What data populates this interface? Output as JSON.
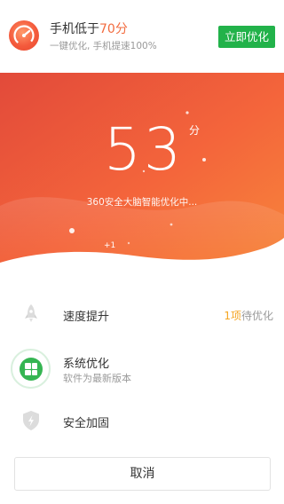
{
  "header": {
    "title_prefix": "手机低于",
    "title_score": "70分",
    "subtitle": "一键优化, 手机提速100%",
    "optimize_button": "立即优化",
    "logo_icon": "speedometer-icon"
  },
  "hero": {
    "score": "53",
    "score_unit": "分",
    "status_text": "360安全大脑智能优化中...",
    "increment_badge": "+1",
    "gradient_colors": [
      "#e8503a",
      "#f36a3a",
      "#f5833a"
    ]
  },
  "items": [
    {
      "title": "速度提升",
      "count": "1项",
      "status": "待优化",
      "icon": "rocket-icon"
    },
    {
      "title": "系统优化",
      "subtitle": "软件为最新版本",
      "icon": "apps-grid-icon"
    },
    {
      "title": "安全加固",
      "icon": "shield-lightning-icon"
    }
  ],
  "cancel_button": "取消",
  "colors": {
    "accent_orange": "#f26b3e",
    "brand_green": "#22b24a",
    "pending_yellow": "#f5a623"
  }
}
